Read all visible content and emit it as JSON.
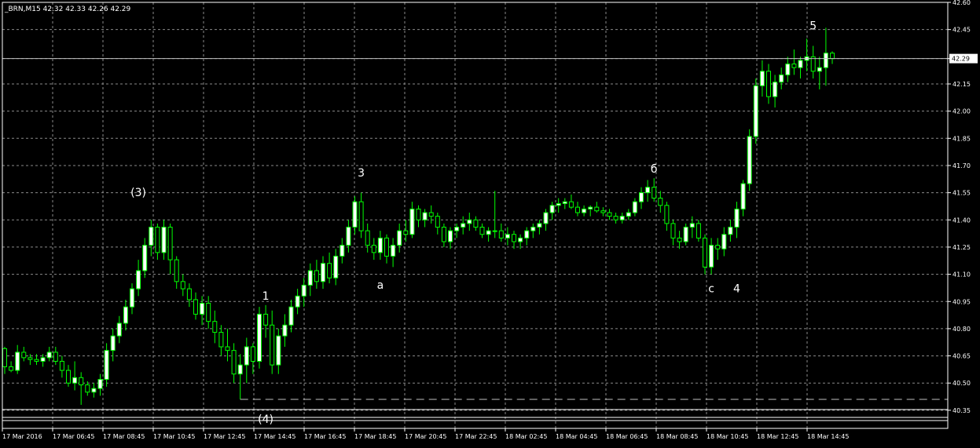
{
  "header": {
    "symbol_info": "_BRN,M15  42.32 42.33 42.26 42.29"
  },
  "colors": {
    "background": "#000000",
    "grid": "#8a8a8a",
    "axis": "#ffffff",
    "bull_body": "#ffffff",
    "bear_body": "#000000",
    "candle_outline": "#00ff00",
    "price_line": "#c0c0c0",
    "support_line": "#c0c0c0"
  },
  "price_label": "42.29",
  "chart_data": {
    "type": "candlestick",
    "symbol": "_BRN",
    "timeframe": "M15",
    "ohlc_last": {
      "open": 42.32,
      "high": 42.33,
      "low": 42.26,
      "close": 42.29
    },
    "current_price": 42.29,
    "support_level": 40.41,
    "ylim": [
      40.25,
      42.6
    ],
    "grid": true,
    "y_ticks": [
      "42.60",
      "42.45",
      "42.29",
      "42.15",
      "42.00",
      "41.85",
      "41.70",
      "41.55",
      "41.40",
      "41.25",
      "41.10",
      "40.95",
      "40.80",
      "40.65",
      "40.50",
      "40.35"
    ],
    "x_ticks": [
      "17 Mar 2016",
      "17 Mar 06:45",
      "17 Mar 08:45",
      "17 Mar 10:45",
      "17 Mar 12:45",
      "17 Mar 14:45",
      "17 Mar 16:45",
      "17 Mar 18:45",
      "17 Mar 20:45",
      "17 Mar 22:45",
      "18 Mar 02:45",
      "18 Mar 04:45",
      "18 Mar 06:45",
      "18 Mar 08:45",
      "18 Mar 10:45",
      "18 Mar 12:45",
      "18 Mar 14:45"
    ],
    "annotations": [
      {
        "text": "(3)",
        "time_index": 21,
        "price": 41.53
      },
      {
        "text": "1",
        "time_index": 41,
        "price": 40.96
      },
      {
        "text": "(4)",
        "time_index": 41,
        "price": 40.28
      },
      {
        "text": "3",
        "time_index": 56,
        "price": 41.64
      },
      {
        "text": "a",
        "time_index": 59,
        "price": 41.02
      },
      {
        "text": "б",
        "time_index": 102,
        "price": 41.66
      },
      {
        "text": "c",
        "time_index": 111,
        "price": 41.0
      },
      {
        "text": "4",
        "time_index": 115,
        "price": 41.0
      },
      {
        "text": "5",
        "time_index": 127,
        "price": 42.45
      }
    ],
    "candles": [
      [
        40.69,
        40.7,
        40.55,
        40.59
      ],
      [
        40.59,
        40.62,
        40.56,
        40.57
      ],
      [
        40.57,
        40.71,
        40.55,
        40.67
      ],
      [
        40.67,
        40.7,
        40.62,
        40.64
      ],
      [
        40.64,
        40.66,
        40.6,
        40.63
      ],
      [
        40.63,
        40.66,
        40.6,
        40.62
      ],
      [
        40.62,
        40.66,
        40.59,
        40.64
      ],
      [
        40.64,
        40.7,
        40.62,
        40.67
      ],
      [
        40.67,
        40.7,
        40.6,
        40.62
      ],
      [
        40.62,
        40.65,
        40.53,
        40.57
      ],
      [
        40.57,
        40.6,
        40.48,
        40.5
      ],
      [
        40.5,
        40.62,
        40.46,
        40.53
      ],
      [
        40.53,
        40.56,
        40.38,
        40.49
      ],
      [
        40.49,
        40.51,
        40.43,
        40.45
      ],
      [
        40.45,
        40.5,
        40.42,
        40.47
      ],
      [
        40.47,
        40.55,
        40.43,
        40.52
      ],
      [
        40.52,
        40.72,
        40.48,
        40.68
      ],
      [
        40.68,
        40.8,
        40.62,
        40.76
      ],
      [
        40.76,
        40.87,
        40.72,
        40.83
      ],
      [
        40.83,
        40.96,
        40.79,
        40.92
      ],
      [
        40.92,
        41.05,
        40.88,
        41.02
      ],
      [
        41.02,
        41.18,
        40.98,
        41.12
      ],
      [
        41.12,
        41.3,
        41.08,
        41.26
      ],
      [
        41.26,
        41.4,
        41.2,
        41.36
      ],
      [
        41.36,
        41.38,
        41.18,
        41.22
      ],
      [
        41.22,
        41.4,
        41.18,
        41.36
      ],
      [
        41.36,
        41.38,
        41.1,
        41.18
      ],
      [
        41.18,
        41.2,
        41.02,
        41.06
      ],
      [
        41.06,
        41.1,
        40.98,
        41.02
      ],
      [
        41.02,
        41.05,
        40.92,
        40.96
      ],
      [
        40.96,
        41.0,
        40.85,
        40.88
      ],
      [
        40.88,
        40.98,
        40.82,
        40.94
      ],
      [
        40.94,
        40.98,
        40.8,
        40.84
      ],
      [
        40.84,
        40.9,
        40.72,
        40.78
      ],
      [
        40.78,
        40.82,
        40.65,
        40.7
      ],
      [
        40.7,
        40.8,
        40.62,
        40.68
      ],
      [
        40.68,
        40.72,
        40.5,
        40.55
      ],
      [
        40.55,
        40.66,
        40.41,
        40.6
      ],
      [
        40.6,
        40.75,
        40.5,
        40.7
      ],
      [
        40.7,
        40.72,
        40.55,
        40.62
      ],
      [
        40.62,
        40.92,
        40.58,
        40.88
      ],
      [
        40.88,
        40.93,
        40.75,
        40.82
      ],
      [
        40.82,
        40.9,
        40.55,
        40.6
      ],
      [
        40.6,
        40.8,
        40.55,
        40.76
      ],
      [
        40.76,
        40.88,
        40.7,
        40.82
      ],
      [
        40.82,
        40.96,
        40.78,
        40.92
      ],
      [
        40.92,
        41.02,
        40.88,
        40.98
      ],
      [
        40.98,
        41.08,
        40.92,
        41.04
      ],
      [
        41.04,
        41.16,
        40.98,
        41.12
      ],
      [
        41.12,
        41.18,
        41.02,
        41.06
      ],
      [
        41.06,
        41.2,
        41.02,
        41.16
      ],
      [
        41.16,
        41.22,
        41.05,
        41.08
      ],
      [
        41.08,
        41.24,
        41.04,
        41.2
      ],
      [
        41.2,
        41.3,
        41.16,
        41.26
      ],
      [
        41.26,
        41.4,
        41.22,
        41.36
      ],
      [
        41.36,
        41.53,
        41.32,
        41.5
      ],
      [
        41.5,
        41.55,
        41.3,
        41.34
      ],
      [
        41.34,
        41.38,
        41.22,
        41.26
      ],
      [
        41.26,
        41.3,
        41.18,
        41.22
      ],
      [
        41.22,
        41.34,
        41.18,
        41.3
      ],
      [
        41.3,
        41.32,
        41.16,
        41.2
      ],
      [
        41.2,
        41.3,
        41.14,
        41.26
      ],
      [
        41.26,
        41.38,
        41.22,
        41.34
      ],
      [
        41.34,
        41.4,
        41.28,
        41.32
      ],
      [
        41.32,
        41.5,
        41.3,
        41.46
      ],
      [
        41.46,
        41.48,
        41.36,
        41.4
      ],
      [
        41.4,
        41.46,
        41.36,
        41.44
      ],
      [
        41.44,
        41.48,
        41.38,
        41.42
      ],
      [
        41.42,
        41.44,
        41.32,
        41.36
      ],
      [
        41.36,
        41.38,
        41.25,
        41.28
      ],
      [
        41.28,
        41.36,
        41.24,
        41.34
      ],
      [
        41.34,
        41.38,
        41.3,
        41.36
      ],
      [
        41.36,
        41.42,
        41.32,
        41.38
      ],
      [
        41.38,
        41.44,
        41.34,
        41.4
      ],
      [
        41.4,
        41.42,
        41.34,
        41.36
      ],
      [
        41.36,
        41.38,
        41.3,
        41.32
      ],
      [
        41.32,
        41.36,
        41.28,
        41.34
      ],
      [
        41.34,
        41.56,
        41.3,
        41.34
      ],
      [
        41.34,
        41.38,
        41.28,
        41.3
      ],
      [
        41.3,
        41.36,
        41.26,
        41.32
      ],
      [
        41.32,
        41.34,
        41.24,
        41.28
      ],
      [
        41.28,
        41.32,
        41.24,
        41.3
      ],
      [
        41.3,
        41.36,
        41.26,
        41.34
      ],
      [
        41.34,
        41.38,
        41.3,
        41.36
      ],
      [
        41.36,
        41.4,
        41.32,
        41.38
      ],
      [
        41.38,
        41.46,
        41.34,
        41.44
      ],
      [
        41.44,
        41.5,
        41.4,
        41.48
      ],
      [
        41.48,
        41.52,
        41.44,
        41.49
      ],
      [
        41.49,
        41.52,
        41.46,
        41.5
      ],
      [
        41.5,
        41.54,
        41.46,
        41.47
      ],
      [
        41.47,
        41.5,
        41.42,
        41.44
      ],
      [
        41.44,
        41.48,
        41.42,
        41.46
      ],
      [
        41.46,
        41.48,
        41.42,
        41.47
      ],
      [
        41.47,
        41.5,
        41.44,
        41.45
      ],
      [
        41.45,
        41.47,
        41.42,
        41.44
      ],
      [
        41.44,
        41.46,
        41.4,
        41.42
      ],
      [
        41.42,
        41.44,
        41.38,
        41.4
      ],
      [
        41.4,
        41.44,
        41.38,
        41.42
      ],
      [
        41.42,
        41.46,
        41.4,
        41.44
      ],
      [
        41.44,
        41.52,
        41.42,
        41.5
      ],
      [
        41.5,
        41.58,
        41.46,
        41.55
      ],
      [
        41.55,
        41.62,
        41.5,
        41.58
      ],
      [
        41.58,
        41.63,
        41.5,
        41.52
      ],
      [
        41.52,
        41.56,
        41.44,
        41.48
      ],
      [
        41.48,
        41.5,
        41.34,
        41.38
      ],
      [
        41.38,
        41.4,
        41.26,
        41.3
      ],
      [
        41.3,
        41.34,
        41.24,
        41.28
      ],
      [
        41.28,
        41.38,
        41.26,
        41.36
      ],
      [
        41.36,
        41.42,
        41.3,
        41.38
      ],
      [
        41.38,
        41.4,
        41.28,
        41.3
      ],
      [
        41.3,
        41.32,
        41.1,
        41.14
      ],
      [
        41.14,
        41.3,
        41.1,
        41.26
      ],
      [
        41.26,
        41.3,
        41.18,
        41.24
      ],
      [
        41.24,
        41.36,
        41.2,
        41.32
      ],
      [
        41.32,
        41.4,
        41.28,
        41.36
      ],
      [
        41.36,
        41.5,
        41.3,
        41.46
      ],
      [
        41.46,
        41.62,
        41.42,
        41.6
      ],
      [
        41.6,
        41.9,
        41.56,
        41.86
      ],
      [
        41.86,
        42.18,
        41.82,
        42.14
      ],
      [
        42.14,
        42.28,
        42.08,
        42.22
      ],
      [
        42.22,
        42.26,
        42.04,
        42.08
      ],
      [
        42.08,
        42.2,
        42.02,
        42.16
      ],
      [
        42.16,
        42.24,
        42.12,
        42.2
      ],
      [
        42.2,
        42.3,
        42.16,
        42.26
      ],
      [
        42.26,
        42.34,
        42.2,
        42.24
      ],
      [
        42.24,
        42.3,
        42.18,
        42.28
      ],
      [
        42.28,
        42.4,
        42.22,
        42.3
      ],
      [
        42.3,
        42.36,
        42.18,
        42.22
      ],
      [
        42.22,
        42.3,
        42.12,
        42.24
      ],
      [
        42.24,
        42.46,
        42.14,
        42.32
      ],
      [
        42.32,
        42.33,
        42.26,
        42.29
      ]
    ]
  }
}
